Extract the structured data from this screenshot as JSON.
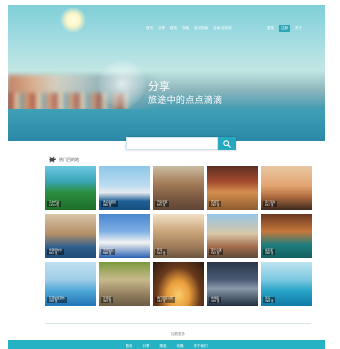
{
  "nav": {
    "items": [
      "首页",
      "分享",
      "精选",
      "攻略",
      "游记指南",
      "当地·目的地"
    ],
    "right": [
      "登录",
      "注册",
      "关于"
    ]
  },
  "hero": {
    "title": "分享",
    "subtitle": "旅途中的点点滴滴"
  },
  "search": {
    "placeholder": "",
    "icon": "search-icon"
  },
  "section": {
    "title": "热门目的地",
    "icon": "turtle-icon"
  },
  "photos": [
    {
      "name": "马尔代夫",
      "meta": "1254 张"
    },
    {
      "name": "悉尼歌剧院",
      "meta": "986 张"
    },
    {
      "name": "巴塞罗那",
      "meta": "875 张"
    },
    {
      "name": "西班牙",
      "meta": "762 张"
    },
    {
      "name": "荷兰风车",
      "meta": "651 张"
    },
    {
      "name": "伊斯坦布尔",
      "meta": "604 张"
    },
    {
      "name": "圣托里尼",
      "meta": "588 张"
    },
    {
      "name": "罗马",
      "meta": "543 张"
    },
    {
      "name": "瑞士小镇",
      "meta": "512 张"
    },
    {
      "name": "威尼斯",
      "meta": "498 张"
    },
    {
      "name": "尼亚加拉瀑布",
      "meta": "476 张"
    },
    {
      "name": "吴哥窟",
      "meta": "455 张"
    },
    {
      "name": "拱门国家公园",
      "meta": "432 张"
    },
    {
      "name": "布拉格",
      "meta": "410 张"
    },
    {
      "name": "冰岛",
      "meta": "398 张"
    }
  ],
  "load_more": "加载更多",
  "footer": [
    "首页",
    "分享",
    "精选",
    "攻略",
    "关于我们"
  ],
  "colors": {
    "accent": "#25b3c4"
  }
}
